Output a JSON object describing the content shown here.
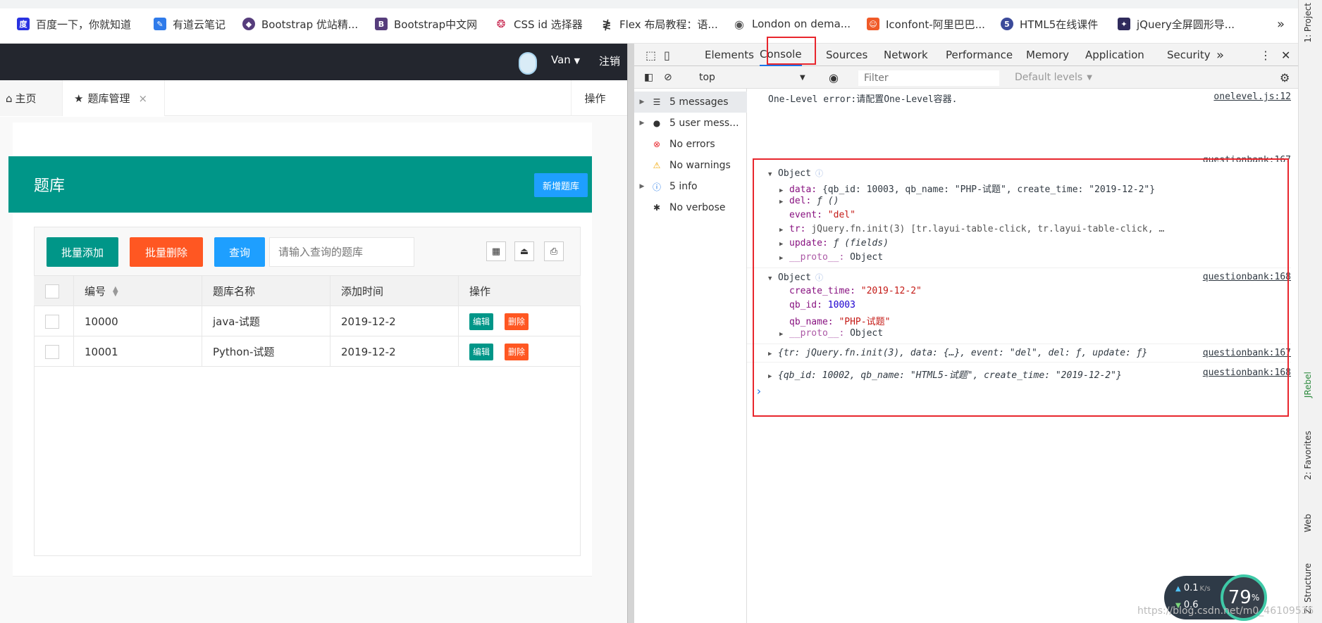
{
  "bookmarks": [
    {
      "label": "百度一下，你就知道",
      "icon": "baidu-icon",
      "color": "#2932e1"
    },
    {
      "label": "有道云笔记",
      "icon": "youdao-note-icon",
      "color": "#2f7bea"
    },
    {
      "label": "Bootstrap 优站精...",
      "icon": "bootstrap-icon",
      "color": "#563d7c"
    },
    {
      "label": "Bootstrap中文网",
      "icon": "bootstrap-b-icon",
      "color": "#563d7c"
    },
    {
      "label": "CSS id 选择器",
      "icon": "runoob-icon",
      "color": "#c7254e"
    },
    {
      "label": "Flex 布局教程：语...",
      "icon": "ruanyf-icon",
      "color": "#333333"
    },
    {
      "label": "London on dema...",
      "icon": "globe-icon",
      "color": "#555555"
    },
    {
      "label": "Iconfont-阿里巴巴...",
      "icon": "iconfont-icon",
      "color": "#f05a28"
    },
    {
      "label": "HTML5在线课件",
      "icon": "html5-icon",
      "color": "#3b4a9a"
    },
    {
      "label": "jQuery全屏圆形导...",
      "icon": "jquery-icon",
      "color": "#2f2b5c"
    }
  ],
  "bookmarks_more": "»",
  "app": {
    "header": {
      "user": "Van",
      "logout": "注销"
    },
    "tabs": {
      "home": "主页",
      "active": "题库管理",
      "close": "×",
      "ops": "操作"
    },
    "card": {
      "title": "题库",
      "add_button": "新增题库"
    },
    "toolbar": {
      "batch_add": "批量添加",
      "batch_delete": "批量删除",
      "query": "查询",
      "search_placeholder": "请输入查询的题库"
    },
    "table": {
      "headers": {
        "id": "编号",
        "name": "题库名称",
        "time": "添加时间",
        "ops": "操作"
      },
      "rows": [
        {
          "id": "10000",
          "name": "java-试题",
          "time": "2019-12-2"
        },
        {
          "id": "10001",
          "name": "Python-试题",
          "time": "2019-12-2"
        }
      ],
      "edit": "编辑",
      "delete": "删除"
    },
    "colors": {
      "header": "#23262e",
      "primary": "#009688",
      "danger": "#ff5722",
      "normal": "#1e9fff"
    }
  },
  "devtools": {
    "tabs": [
      "Elements",
      "Console",
      "Sources",
      "Network",
      "Performance",
      "Memory",
      "Application",
      "Security"
    ],
    "active_tab": "Console",
    "more": "»",
    "context": "top",
    "filter_placeholder": "Filter",
    "levels": "Default levels",
    "sidebar": [
      {
        "label": "5 messages",
        "icon": "list-icon",
        "expandable": true
      },
      {
        "label": "5 user mess...",
        "icon": "user-icon",
        "expandable": true
      },
      {
        "label": "No errors",
        "icon": "error-icon",
        "expandable": false
      },
      {
        "label": "No warnings",
        "icon": "warning-icon",
        "expandable": false
      },
      {
        "label": "5 info",
        "icon": "info-icon",
        "expandable": true
      },
      {
        "label": "No verbose",
        "icon": "bug-icon",
        "expandable": false
      }
    ],
    "console": {
      "error_line": "One-Level error:请配置One-Level容器.",
      "error_src": "onelevel.js:12",
      "src167": "questionbank:167",
      "src168": "questionbank:168",
      "obj_label": "Object",
      "obj1": {
        "data_key": "data:",
        "data_val": "{qb_id: 10003, qb_name: \"PHP-试题\", create_time: \"2019-12-2\"}",
        "del_key": "del:",
        "del_val": "ƒ ()",
        "event_key": "event:",
        "event_val": "\"del\"",
        "tr_key": "tr:",
        "tr_val": "jQuery.fn.init(3) [tr.layui-table-click, tr.layui-table-click, …",
        "update_key": "update:",
        "update_val": "ƒ (fields)",
        "proto_key": "__proto__:",
        "proto_val": "Object"
      },
      "obj2": {
        "ct_key": "create_time:",
        "ct_val": "\"2019-12-2\"",
        "id_key": "qb_id:",
        "id_val": "10003",
        "name_key": "qb_name:",
        "name_val": "\"PHP-试题\"",
        "proto_key": "__proto__:",
        "proto_val": "Object"
      },
      "line3": "{tr: jQuery.fn.init(3), data: {…}, event: \"del\", del: ƒ, update: ƒ}",
      "line4": "{qb_id: 10002, qb_name: \"HTML5-试题\", create_time: \"2019-12-2\"}",
      "prompt": "›"
    }
  },
  "rail": {
    "project": "1: Project",
    "jrebel": "JRebel",
    "favorites": "2: Favorites",
    "web": "Web",
    "structure": "Z: Structure"
  },
  "overlay": {
    "speed_up": "0.1",
    "speed_unit": "K/s",
    "speed_down": "0.6",
    "percent": "79",
    "percent_sign": "%",
    "watermark": "https://blog.csdn.net/m0_46109535"
  }
}
